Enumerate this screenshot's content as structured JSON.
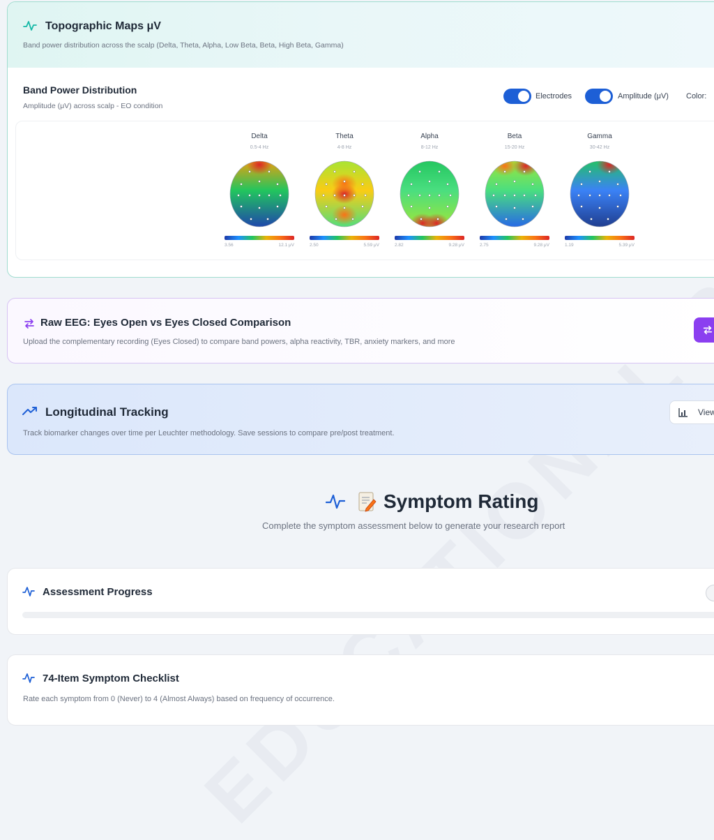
{
  "topo": {
    "title": "Topographic Maps μV",
    "subtitle": "Band power distribution across the scalp (Delta, Theta, Alpha, Low Beta, Beta, High Beta, Gamma)",
    "panel_title": "Band Power Distribution",
    "panel_subtitle": "Amplitude (μV) across scalp - EO condition",
    "toggles": [
      {
        "label": "Electrodes",
        "on": true
      },
      {
        "label": "Amplitude (μV)",
        "on": true
      }
    ],
    "color_label": "Color:",
    "bands": [
      {
        "name": "Delta",
        "range": "0.5-4 Hz",
        "min": "3.56",
        "max": "12.1 μV",
        "palette": "delta"
      },
      {
        "name": "Theta",
        "range": "4-8 Hz",
        "min": "2.50",
        "max": "5.59 μV",
        "palette": "theta"
      },
      {
        "name": "Alpha",
        "range": "8-12 Hz",
        "min": "2.82",
        "max": "9.28 μV",
        "palette": "alpha"
      },
      {
        "name": "Beta",
        "range": "15-20 Hz",
        "min": "2.75",
        "max": "9.28 μV",
        "palette": "beta"
      },
      {
        "name": "Gamma",
        "range": "30-42 Hz",
        "min": "1.19",
        "max": "5.39 μV",
        "palette": "gamma"
      }
    ]
  },
  "raw": {
    "title": "Raw EEG: Eyes Open vs Eyes Closed Comparison",
    "subtitle": "Upload the complementary recording (Eyes Closed) to compare band powers, alpha reactivity, TBR, anxiety markers, and more",
    "button_icon": "swap-icon"
  },
  "longitudinal": {
    "title": "Longitudinal Tracking",
    "subtitle": "Track biomarker changes over time per Leuchter methodology. Save sessions to compare pre/post treatment.",
    "button_label": "View"
  },
  "symptom": {
    "title": "Symptom Rating",
    "subtitle": "Complete the symptom assessment below to generate your research report"
  },
  "progress": {
    "title": "Assessment Progress"
  },
  "checklist": {
    "title": "74-Item Symptom Checklist",
    "subtitle": "Rate each symptom from 0 (Never) to 4 (Almost Always) based on frequency of occurrence."
  },
  "watermark": "EDUCATIONAL REFERENCE",
  "colors": {
    "accent_teal": "#14b8a6",
    "accent_purple": "#8b3ff0",
    "accent_blue": "#1d5fd6",
    "toggle_on": "#1d5fd6"
  }
}
